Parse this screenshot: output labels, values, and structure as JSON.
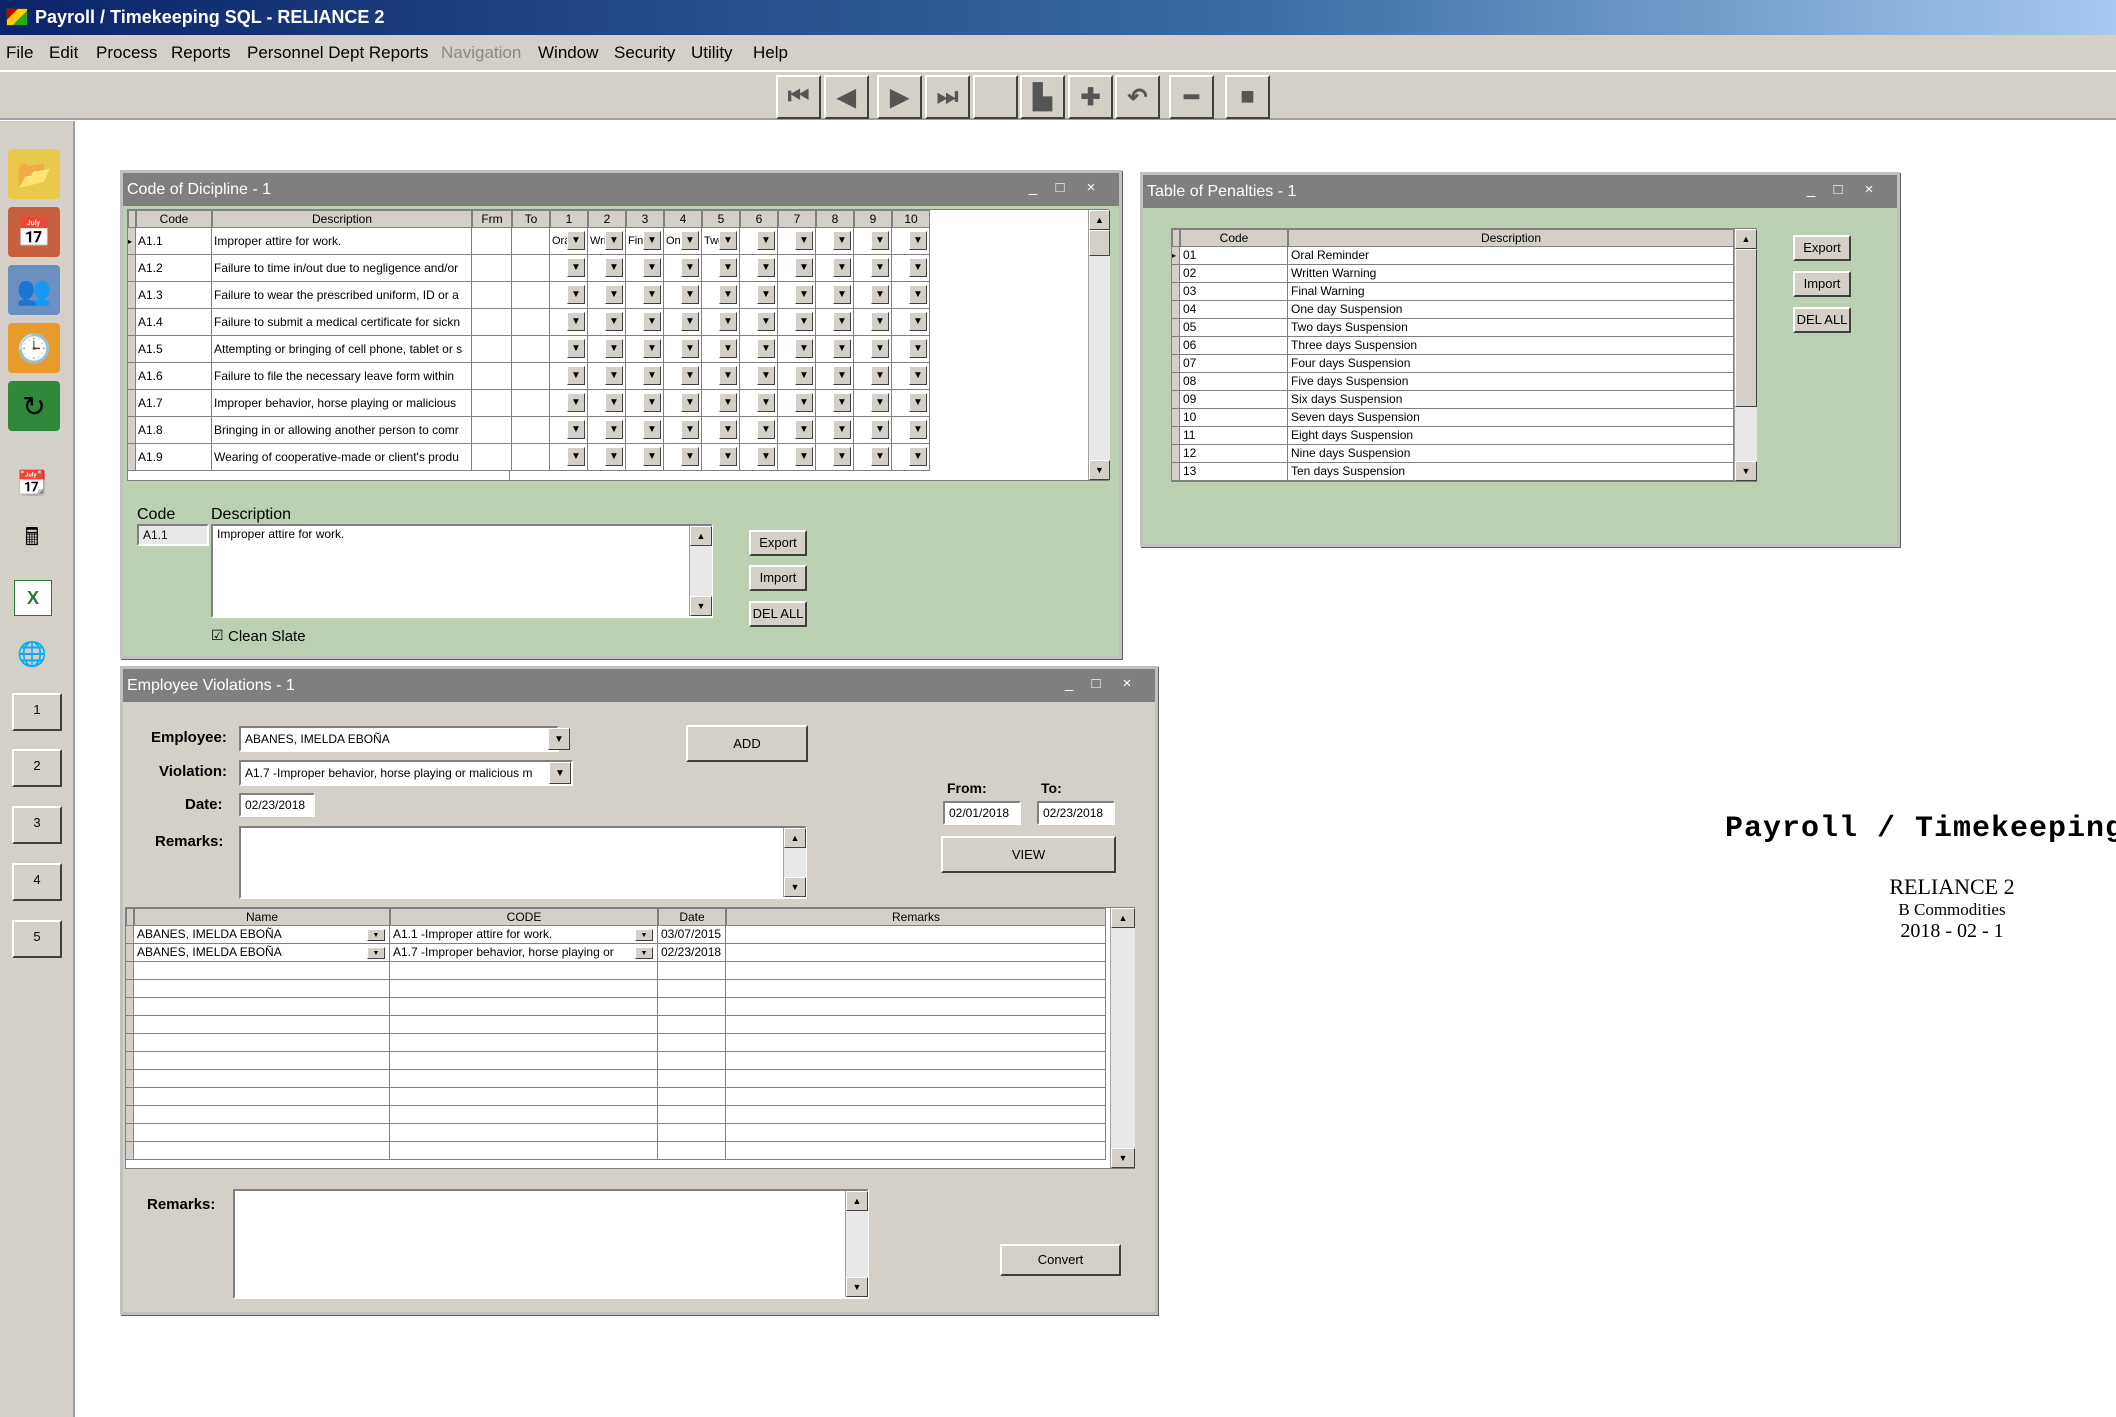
{
  "app": {
    "title": "Payroll / Timekeeping SQL - RELIANCE 2"
  },
  "menu": [
    "File",
    "Edit",
    "Process",
    "Reports",
    "Personnel Dept Reports",
    "Navigation",
    "Window",
    "Security",
    "Utility",
    "Help"
  ],
  "menu_disabled": [
    "Navigation"
  ],
  "toolbar": {
    "buttons": [
      "first-record",
      "previous-record",
      "next-record",
      "last-record",
      "blank",
      "save",
      "add",
      "undo",
      "delete",
      "stop"
    ]
  },
  "sidebar": {
    "numbers": [
      "1",
      "2",
      "3",
      "4",
      "5"
    ]
  },
  "discipline_window": {
    "title": "Code of Dicipline - 1",
    "controls": [
      "_",
      "□",
      "×"
    ],
    "headers": [
      "Code",
      "Description",
      "Frm",
      "To",
      "1",
      "2",
      "3",
      "4",
      "5",
      "6",
      "7",
      "8",
      "9",
      "10"
    ],
    "rows": [
      {
        "code": "A1.1",
        "desc": "Improper attire for work.",
        "p": [
          "Ora",
          "Wri",
          "Fin",
          "One",
          "Two"
        ]
      },
      {
        "code": "A1.2",
        "desc": "Failure to time in/out due to negligence and/or",
        "p": []
      },
      {
        "code": "A1.3",
        "desc": "Failure to wear the prescribed uniform, ID or a",
        "p": []
      },
      {
        "code": "A1.4",
        "desc": "Failure to submit a medical certificate for sickn",
        "p": []
      },
      {
        "code": "A1.5",
        "desc": "Attempting or bringing of cell phone, tablet or s",
        "p": []
      },
      {
        "code": "A1.6",
        "desc": "Failure to file the necessary leave form within",
        "p": []
      },
      {
        "code": "A1.7",
        "desc": "Improper behavior, horse playing or malicious",
        "p": []
      },
      {
        "code": "A1.8",
        "desc": "Bringing in or allowing another person to comr",
        "p": []
      },
      {
        "code": "A1.9",
        "desc": "Wearing of cooperative-made or client's produ",
        "p": []
      }
    ],
    "detail": {
      "code_label": "Code",
      "desc_label": "Description",
      "code_value": "A1.1",
      "desc_value": "Improper attire for work.",
      "clean_slate_label": "Clean Slate",
      "clean_slate_checked": "☑"
    },
    "buttons": {
      "export": "Export",
      "import": "Import",
      "delall": "DEL ALL"
    }
  },
  "penalties_window": {
    "title": "Table of  Penalties - 1",
    "controls": [
      "_",
      "□",
      "×"
    ],
    "headers": [
      "Code",
      "Description"
    ],
    "rows": [
      {
        "code": "01",
        "desc": "Oral Reminder"
      },
      {
        "code": "02",
        "desc": "Written Warning"
      },
      {
        "code": "03",
        "desc": "Final Warning"
      },
      {
        "code": "04",
        "desc": "One day Suspension"
      },
      {
        "code": "05",
        "desc": "Two days Suspension"
      },
      {
        "code": "06",
        "desc": "Three days Suspension"
      },
      {
        "code": "07",
        "desc": "Four days Suspension"
      },
      {
        "code": "08",
        "desc": "Five days Suspension"
      },
      {
        "code": "09",
        "desc": "Six days Suspension"
      },
      {
        "code": "10",
        "desc": "Seven days Suspension"
      },
      {
        "code": "11",
        "desc": "Eight days Suspension"
      },
      {
        "code": "12",
        "desc": "Nine days Suspension"
      },
      {
        "code": "13",
        "desc": "Ten days Suspension"
      }
    ],
    "buttons": {
      "export": "Export",
      "import": "Import",
      "delall": "DEL ALL"
    }
  },
  "violations_window": {
    "title": "Employee Violations - 1",
    "controls": [
      "_",
      "□",
      "×"
    ],
    "employee_label": "Employee:",
    "employee_value": "ABANES, IMELDA EBOÑA",
    "violation_label": "Violation:",
    "violation_value": "A1.7   -Improper behavior, horse playing or malicious m",
    "date_label": "Date:",
    "date_value": "02/23/2018",
    "remarks_label": "Remarks:",
    "add_button": "ADD",
    "from_label": "From:",
    "to_label": "To:",
    "from_value": "02/01/2018",
    "to_value": "02/23/2018",
    "view_button": "VIEW",
    "grid_headers": [
      "Name",
      "CODE",
      "Date",
      "Remarks"
    ],
    "grid_rows": [
      {
        "name": "ABANES, IMELDA EBOÑA",
        "code": "A1.1   -Improper attire for work.",
        "date": "03/07/2015",
        "remarks": ""
      },
      {
        "name": "ABANES, IMELDA EBOÑA",
        "code": "A1.7   -Improper behavior, horse playing or",
        "date": "02/23/2018",
        "remarks": ""
      }
    ],
    "bottom_remarks_label": "Remarks:",
    "convert_button": "Convert"
  },
  "branding": {
    "title": "Payroll / Timekeeping",
    "company": "RELIANCE 2",
    "subtitle": "B Commodities",
    "period": "2018 - 02 - 1"
  }
}
